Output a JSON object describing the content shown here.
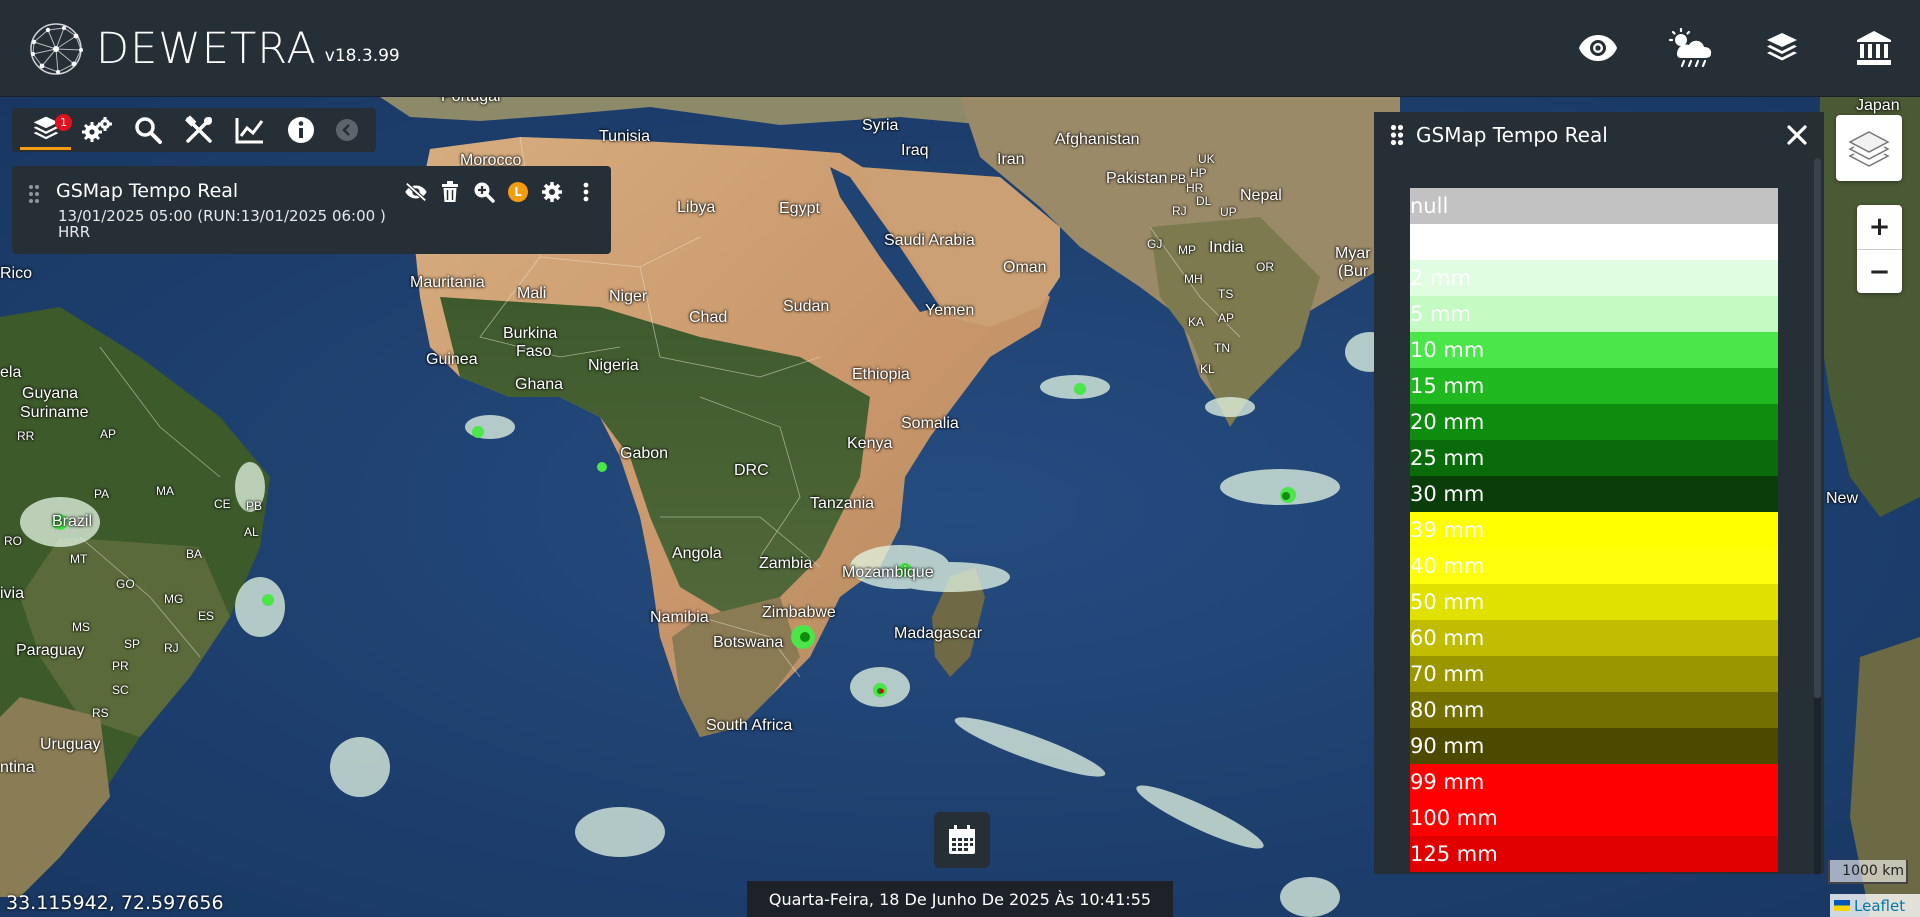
{
  "app": {
    "name": "DEWETRA",
    "version": "v18.3.99"
  },
  "header_icons": [
    "eye-icon",
    "weather-icon",
    "layers-icon",
    "institution-icon"
  ],
  "toolbar": {
    "icons": [
      "layers-icon",
      "settings-icon",
      "search-icon",
      "tools-icon",
      "chart-icon",
      "info-icon",
      "collapse-icon"
    ],
    "badge": "1"
  },
  "layer": {
    "title": "GSMap Tempo Real",
    "date_line": "13/01/2025 05:00 (RUN:13/01/2025 06:00 )",
    "unit_line": "HRR",
    "l_badge": "L"
  },
  "legend": {
    "title": "GSMap Tempo Real",
    "entries": [
      {
        "label": "null",
        "color": "#c2c2c2"
      },
      {
        "label": "",
        "color": "#ffffff"
      },
      {
        "label": "2 mm",
        "color": "#e1fde1"
      },
      {
        "label": "5 mm",
        "color": "#c3fbc3"
      },
      {
        "label": "10 mm",
        "color": "#4ae64a"
      },
      {
        "label": "15 mm",
        "color": "#1fb81f"
      },
      {
        "label": "20 mm",
        "color": "#0e8c0e"
      },
      {
        "label": "25 mm",
        "color": "#0a6b0a"
      },
      {
        "label": "30 mm",
        "color": "#0b3d0b"
      },
      {
        "label": "39 mm",
        "color": "#ffff00"
      },
      {
        "label": "40 mm",
        "color": "#ffff0a"
      },
      {
        "label": "50 mm",
        "color": "#e1e100"
      },
      {
        "label": "60 mm",
        "color": "#c0bd00"
      },
      {
        "label": "70 mm",
        "color": "#9a9600"
      },
      {
        "label": "80 mm",
        "color": "#736f00"
      },
      {
        "label": "90 mm",
        "color": "#4d4a00"
      },
      {
        "label": "99 mm",
        "color": "#ff0000"
      },
      {
        "label": "100 mm",
        "color": "#ff0000"
      },
      {
        "label": "125 mm",
        "color": "#e00000"
      }
    ]
  },
  "map": {
    "labels": [
      {
        "text": "Portugal"
      },
      {
        "text": "Tunisia"
      },
      {
        "text": "Syria"
      },
      {
        "text": "Iraq"
      },
      {
        "text": "Afghanistan"
      },
      {
        "text": "Morocco"
      },
      {
        "text": "Iran"
      },
      {
        "text": "Pakistan"
      },
      {
        "text": "Nepal"
      },
      {
        "text": "Libya"
      },
      {
        "text": "Egypt"
      },
      {
        "text": "Saudi Arabia"
      },
      {
        "text": "India"
      },
      {
        "text": "Oman"
      },
      {
        "text": "Mauritania"
      },
      {
        "text": "Mali"
      },
      {
        "text": "Niger"
      },
      {
        "text": "Sudan"
      },
      {
        "text": "Yemen"
      },
      {
        "text": "Chad"
      },
      {
        "text": "Burkina"
      },
      {
        "text": "Faso"
      },
      {
        "text": "Guinea"
      },
      {
        "text": "Nigeria"
      },
      {
        "text": "Ethiopia"
      },
      {
        "text": "Ghana"
      },
      {
        "text": "Somalia"
      },
      {
        "text": "Gabon"
      },
      {
        "text": "Kenya"
      },
      {
        "text": "DRC"
      },
      {
        "text": "Tanzania"
      },
      {
        "text": "Angola"
      },
      {
        "text": "Zambia"
      },
      {
        "text": "Mozambique"
      },
      {
        "text": "Namibia"
      },
      {
        "text": "Zimbabwe"
      },
      {
        "text": "Botswana"
      },
      {
        "text": "Madagascar"
      },
      {
        "text": "South Africa"
      },
      {
        "text": "Guyana"
      },
      {
        "text": "Suriname"
      },
      {
        "text": "Brazil"
      },
      {
        "text": "Paraguay"
      },
      {
        "text": "Uruguay"
      },
      {
        "text": "Rico"
      },
      {
        "text": "ela"
      },
      {
        "text": "ivia"
      },
      {
        "text": "ntina"
      },
      {
        "text": "Myar"
      },
      {
        "text": "(Bur"
      },
      {
        "text": "New"
      },
      {
        "text": "Japan"
      }
    ],
    "small_labels": [
      "UK",
      "HP",
      "PB",
      "HR",
      "RJ",
      "DL",
      "UP",
      "GJ",
      "MP",
      "MH",
      "TS",
      "OR",
      "KA",
      "AP",
      "TN",
      "KL",
      "RR",
      "AP",
      "PA",
      "MA",
      "CE",
      "PB",
      "AL",
      "RO",
      "MT",
      "BA",
      "GO",
      "MG",
      "ES",
      "MS",
      "SP",
      "RJ",
      "PR",
      "SC",
      "RS"
    ]
  },
  "bottom": {
    "datetime": "Quarta-Feira, 18 De Junho De 2025 Às 10:41:55",
    "coords": "33.115942, 72.597656",
    "scale": "1000 km",
    "attribution": "Leaflet"
  },
  "controls": {
    "zoom_in": "+",
    "zoom_out": "−",
    "close": "✕"
  }
}
